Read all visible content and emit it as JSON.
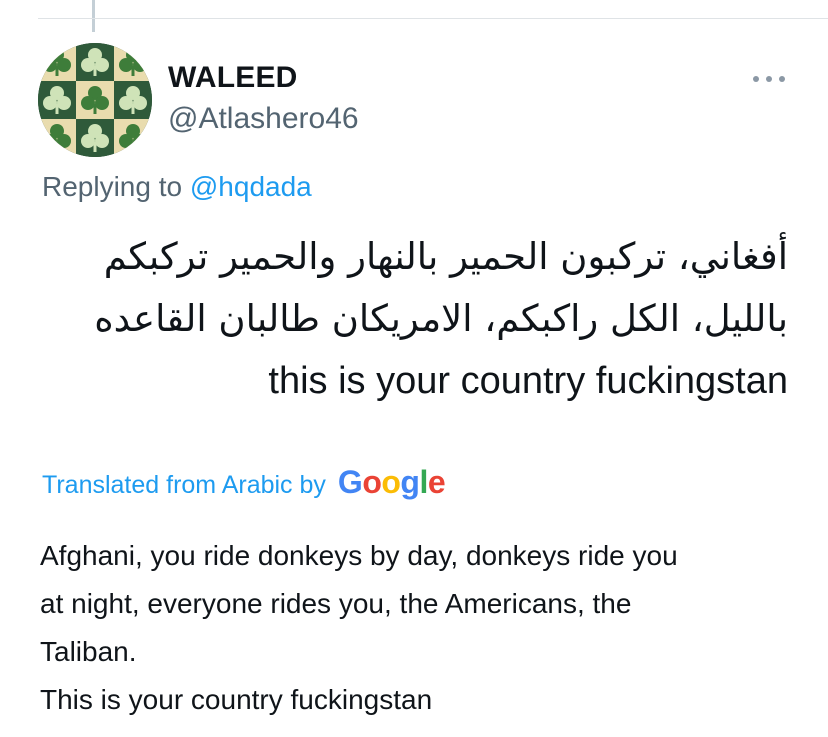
{
  "author": {
    "display_name": "WALEED",
    "handle": "@Atlashero46",
    "avatar_icon": "shamrock-pattern-icon"
  },
  "more_icon": "more-dots-icon",
  "reply": {
    "prefix": "Replying to",
    "mention": "@hqdada"
  },
  "tweet": {
    "arabic_text": "أفغاني، تركبون الحمير بالنهار والحمير تركبكم بالليل، الكل راكبكم، الامريكان طالبان القاعده",
    "english_line": "this is your country fuckingstan"
  },
  "translation": {
    "label": "Translated from Arabic by",
    "provider": "Google",
    "text": "Afghani, you ride donkeys by day, donkeys ride you\nat night, everyone rides you, the Americans, the\nTaliban.\n This is your country fuckingstan"
  },
  "colors": {
    "link_blue": "#1d9bf0",
    "secondary_text": "#536471",
    "primary_text": "#0f1419",
    "google_blue": "#4285f4",
    "google_red": "#ea4335",
    "google_yellow": "#fbbc05",
    "google_green": "#34a853"
  }
}
